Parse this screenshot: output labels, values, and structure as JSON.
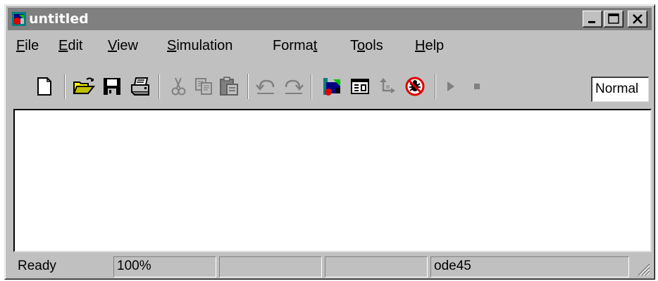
{
  "window": {
    "title": "untitled",
    "controls": [
      "minimize-icon",
      "maximize-icon",
      "close-icon"
    ]
  },
  "menu": {
    "file": {
      "first": "F",
      "rest": "ile"
    },
    "edit": {
      "first": "E",
      "rest": "dit"
    },
    "view": {
      "first": "V",
      "rest": "iew"
    },
    "simulation": {
      "first": "S",
      "rest": "imulation"
    },
    "format": {
      "pre": "Forma",
      "mnemonic": "t",
      "post": ""
    },
    "tools": {
      "pre": "T",
      "mnemonic": "o",
      "post": "ols"
    },
    "help": {
      "first": "H",
      "rest": "elp"
    }
  },
  "toolbar": {
    "icons": [
      "new-icon",
      "open-icon",
      "save-icon",
      "print-icon",
      "cut-icon",
      "copy-icon",
      "paste-icon",
      "undo-icon",
      "redo-icon",
      "library-browser-icon",
      "model-explorer-icon",
      "navigate-up-icon",
      "debug-icon",
      "start-icon",
      "stop-icon"
    ],
    "simulation_mode": "Normal"
  },
  "status": {
    "state": "Ready",
    "zoom": "100%",
    "pane3": "",
    "pane4": "",
    "solver": "ode45"
  }
}
